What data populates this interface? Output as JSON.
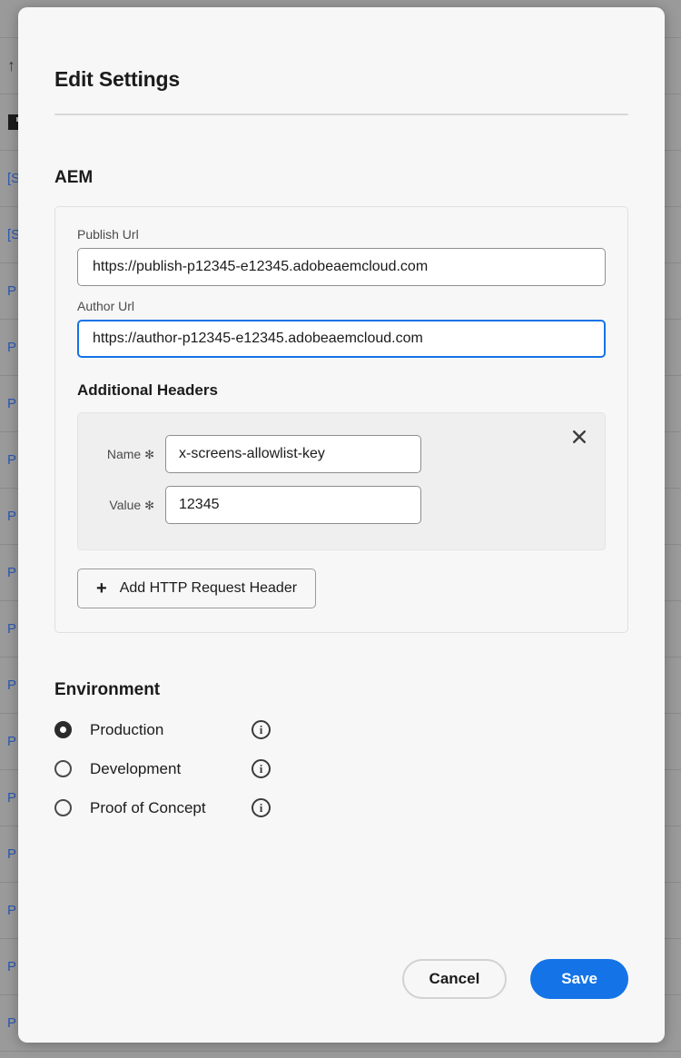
{
  "dialog": {
    "title": "Edit Settings"
  },
  "aem": {
    "section_title": "AEM",
    "publish_url": {
      "label": "Publish Url",
      "value": "https://publish-p12345-e12345.adobeaemcloud.com",
      "placeholder": "Publish Url"
    },
    "author_url": {
      "label": "Author Url",
      "value": "https://author-p12345-e12345.adobeaemcloud.com",
      "placeholder": "Author Url",
      "focused": true
    },
    "additional_headers": {
      "title": "Additional Headers",
      "rows": [
        {
          "name_label": "Name",
          "name_required": "✻",
          "name_value": "x-screens-allowlist-key",
          "value_label": "Value",
          "value_required": "✻",
          "value_value": "12345",
          "remove_icon": "close-icon"
        }
      ],
      "add_button_label": "Add HTTP Request Header",
      "add_button_icon": "plus-icon"
    }
  },
  "environment": {
    "title": "Environment",
    "selected": "Production",
    "options": [
      {
        "label": "Production",
        "checked": true,
        "info_icon": "info-icon"
      },
      {
        "label": "Development",
        "checked": false,
        "info_icon": "info-icon"
      },
      {
        "label": "Proof of Concept",
        "checked": false,
        "info_icon": "info-icon"
      }
    ]
  },
  "footer": {
    "cancel_label": "Cancel",
    "save_label": "Save"
  },
  "colors": {
    "accent_blue": "#1473E6",
    "modal_bg": "#F7F7F7",
    "backdrop": "#9A9A9A",
    "link_blue": "#2B57B5"
  },
  "background": {
    "rows": [
      {
        "text": "",
        "icon": ""
      },
      {
        "text": "",
        "icon": "arrow-up-icon"
      },
      {
        "text": "",
        "icon": "book-icon"
      },
      {
        "text": "[S",
        "icon": ""
      },
      {
        "text": "[S",
        "icon": ""
      },
      {
        "text": "P",
        "icon": ""
      },
      {
        "text": "P",
        "icon": ""
      },
      {
        "text": "P",
        "icon": ""
      },
      {
        "text": "P",
        "icon": ""
      },
      {
        "text": "P",
        "icon": ""
      },
      {
        "text": "P",
        "icon": ""
      },
      {
        "text": "P",
        "icon": ""
      },
      {
        "text": "P",
        "icon": ""
      },
      {
        "text": "P",
        "icon": ""
      },
      {
        "text": "P",
        "icon": ""
      },
      {
        "text": "P",
        "icon": ""
      },
      {
        "text": "P",
        "icon": ""
      },
      {
        "text": "P",
        "icon": ""
      },
      {
        "text": "P",
        "icon": ""
      }
    ]
  }
}
